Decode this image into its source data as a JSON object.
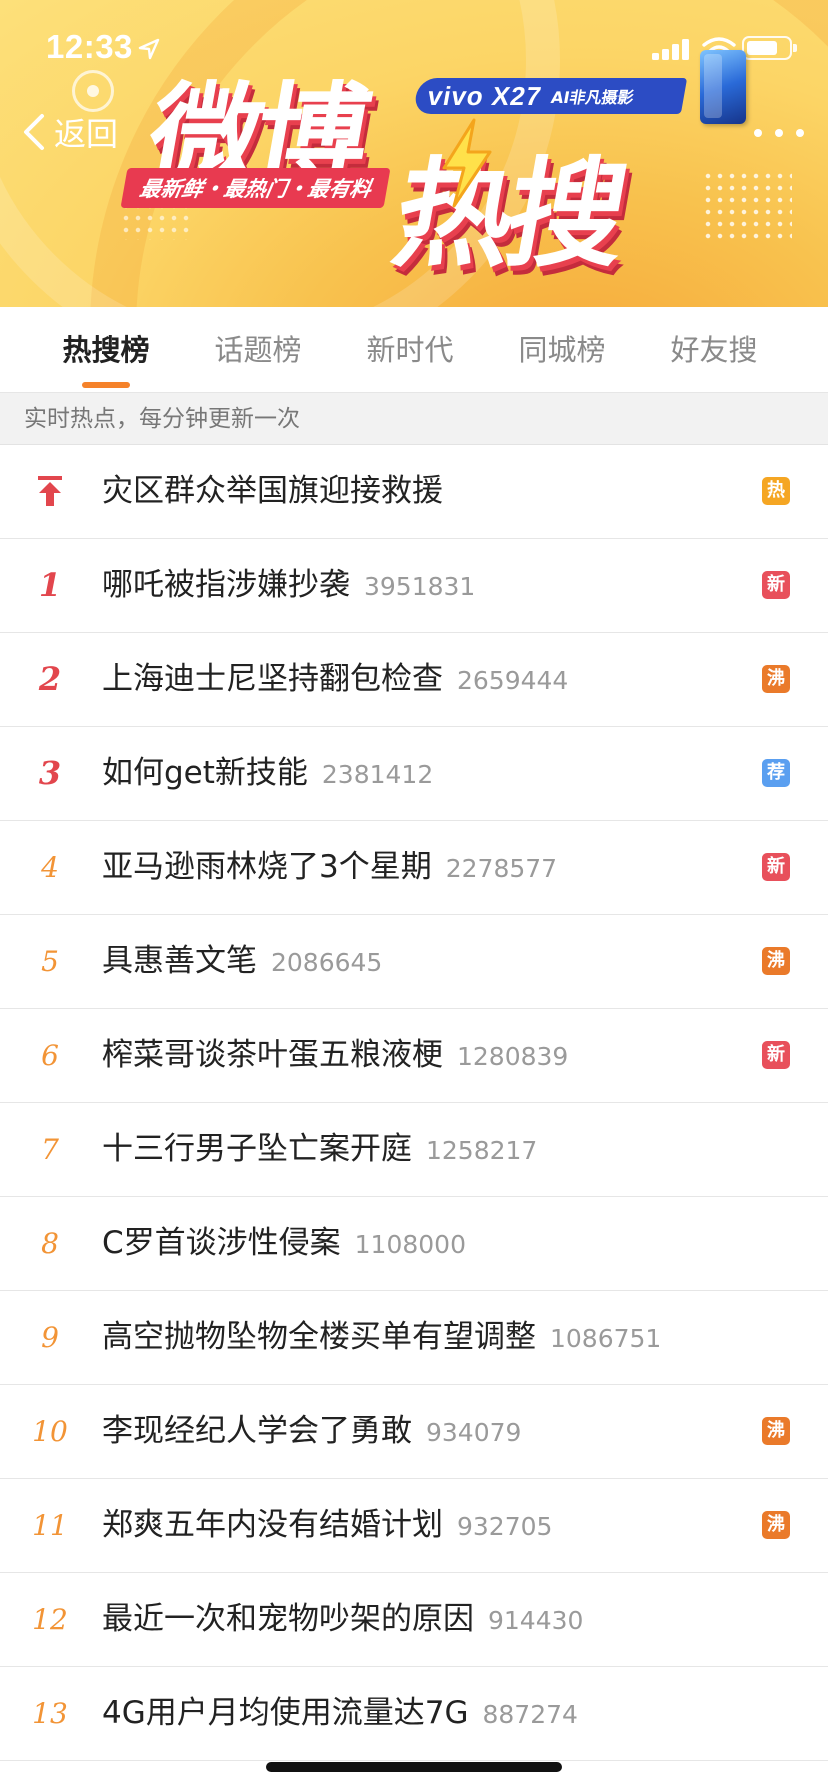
{
  "status_bar": {
    "time": "12:33"
  },
  "nav": {
    "back_label": "返回"
  },
  "banner": {
    "title_part1": "微博",
    "title_part2": "热搜",
    "slogan": "最新鲜・最热门・最有料",
    "ad_brand": "vivo X27",
    "ad_subtitle": "AI非凡摄影"
  },
  "tabs": [
    {
      "label": "热搜榜",
      "active": true
    },
    {
      "label": "话题榜",
      "active": false
    },
    {
      "label": "新时代",
      "active": false
    },
    {
      "label": "同城榜",
      "active": false
    },
    {
      "label": "好友搜",
      "active": false
    }
  ],
  "note": "实时热点，每分钟更新一次",
  "badge_colors": {
    "热": "#f5a623",
    "新": "#e8505b",
    "沸": "#ea7a2a",
    "荐": "#5a9ff0"
  },
  "items": [
    {
      "rank": "",
      "pinned": true,
      "title": "灾区群众举国旗迎接救援",
      "count": "",
      "badge": "热"
    },
    {
      "rank": "1",
      "title": "哪吒被指涉嫌抄袭",
      "count": "3951831",
      "badge": "新"
    },
    {
      "rank": "2",
      "title": "上海迪士尼坚持翻包检查",
      "count": "2659444",
      "badge": "沸"
    },
    {
      "rank": "3",
      "title": "如何get新技能",
      "count": "2381412",
      "badge": "荐"
    },
    {
      "rank": "4",
      "title": "亚马逊雨林烧了3个星期",
      "count": "2278577",
      "badge": "新"
    },
    {
      "rank": "5",
      "title": "具惠善文笔",
      "count": "2086645",
      "badge": "沸"
    },
    {
      "rank": "6",
      "title": "榨菜哥谈茶叶蛋五粮液梗",
      "count": "1280839",
      "badge": "新"
    },
    {
      "rank": "7",
      "title": "十三行男子坠亡案开庭",
      "count": "1258217",
      "badge": ""
    },
    {
      "rank": "8",
      "title": "C罗首谈涉性侵案",
      "count": "1108000",
      "badge": ""
    },
    {
      "rank": "9",
      "title": "高空抛物坠物全楼买单有望调整",
      "count": "1086751",
      "badge": ""
    },
    {
      "rank": "10",
      "title": "李现经纪人学会了勇敢",
      "count": "934079",
      "badge": "沸"
    },
    {
      "rank": "11",
      "title": "郑爽五年内没有结婚计划",
      "count": "932705",
      "badge": "沸"
    },
    {
      "rank": "12",
      "title": "最近一次和宠物吵架的原因",
      "count": "914430",
      "badge": ""
    },
    {
      "rank": "13",
      "title": "4G用户月均使用流量达7G",
      "count": "887274",
      "badge": ""
    }
  ]
}
